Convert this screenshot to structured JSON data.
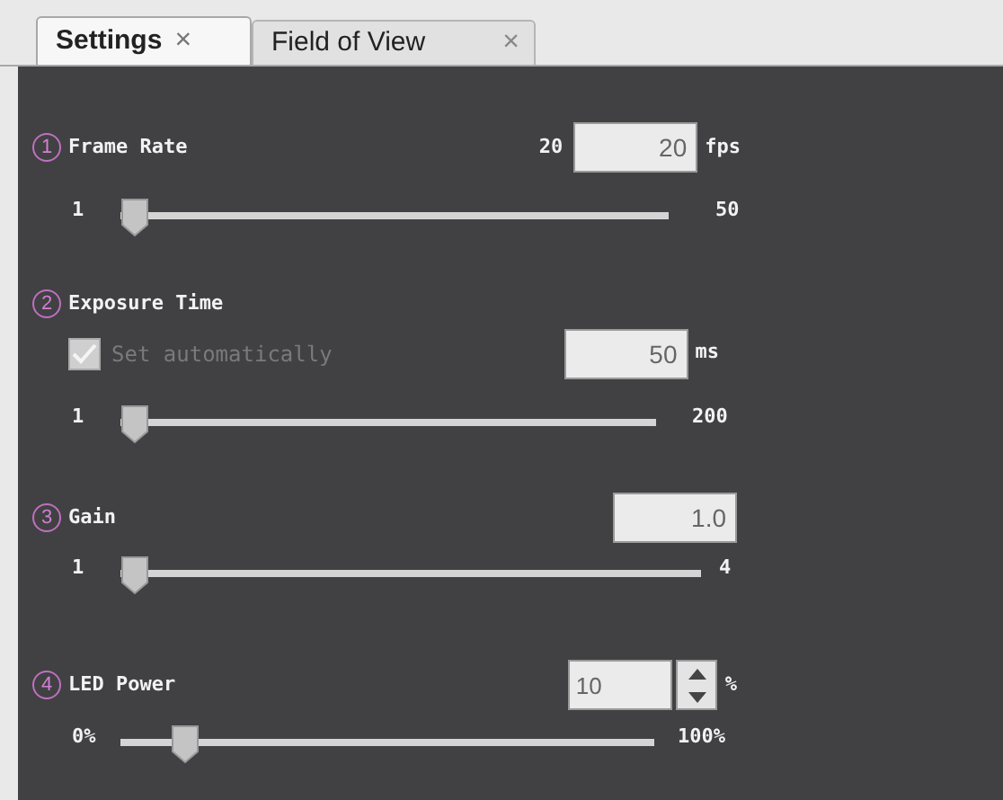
{
  "tabs": [
    {
      "label": "Settings",
      "selected": true,
      "close": "×"
    },
    {
      "label": "Field of View",
      "selected": false,
      "close": "×"
    }
  ],
  "sections": [
    {
      "kind": "number",
      "number": "1",
      "label": "Frame Rate",
      "prefix": "20",
      "value": "20",
      "unit": "fps",
      "min_label": "1",
      "max_label": "50",
      "level": 0
    },
    {
      "kind": "number",
      "number": "2",
      "label": "Exposure Time",
      "checkbox": {
        "label": "Set automatically",
        "checked": true,
        "disabled": true
      },
      "value": "50",
      "unit": "ms",
      "min_label": "1",
      "max_label": "200",
      "level": 0
    },
    {
      "kind": "number",
      "number": "3",
      "label": "Gain",
      "value": "1.0",
      "min_label": "1",
      "max_label": "4",
      "level": 0
    },
    {
      "kind": "spinbox",
      "number": "4",
      "label": "LED Power",
      "value": "10",
      "unit": "%",
      "min_label": "0%",
      "max_label": "100%",
      "level": 0.1
    }
  ]
}
